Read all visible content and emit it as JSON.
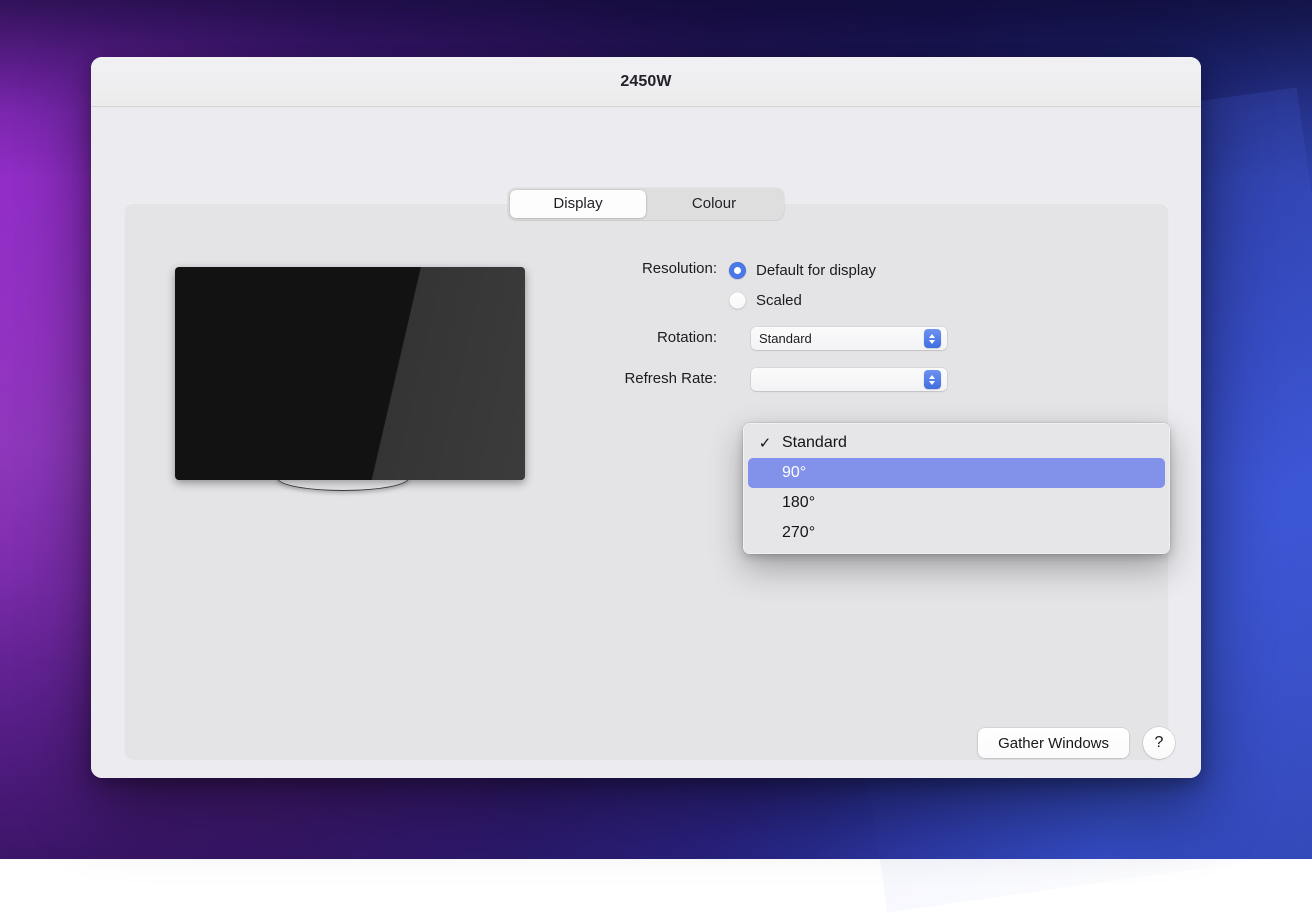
{
  "desktop": {
    "wallpaper_colors": [
      "#8a2ec4",
      "#4a1580",
      "#241157",
      "#2540b4"
    ]
  },
  "window": {
    "title": "2450W",
    "tabs": [
      {
        "label": "Display",
        "selected": true
      },
      {
        "label": "Colour",
        "selected": false
      }
    ]
  },
  "display_preview": {
    "icon": "external-display-tv"
  },
  "form": {
    "resolution": {
      "label": "Resolution:",
      "options": [
        {
          "label": "Default for display",
          "selected": true
        },
        {
          "label": "Scaled",
          "selected": false
        }
      ]
    },
    "rotation": {
      "label": "Rotation:",
      "value": "Standard"
    },
    "refresh_rate": {
      "label": "Refresh Rate:",
      "value": ""
    }
  },
  "rotation_menu": {
    "open": true,
    "items": [
      {
        "label": "Standard",
        "checked": true,
        "highlighted": false
      },
      {
        "label": "90°",
        "checked": false,
        "highlighted": true
      },
      {
        "label": "180°",
        "checked": false,
        "highlighted": false
      },
      {
        "label": "270°",
        "checked": false,
        "highlighted": false
      }
    ],
    "check_glyph": "✓",
    "highlight_color": "#8292ea"
  },
  "footer": {
    "gather_windows_label": "Gather Windows",
    "help_label": "?"
  }
}
